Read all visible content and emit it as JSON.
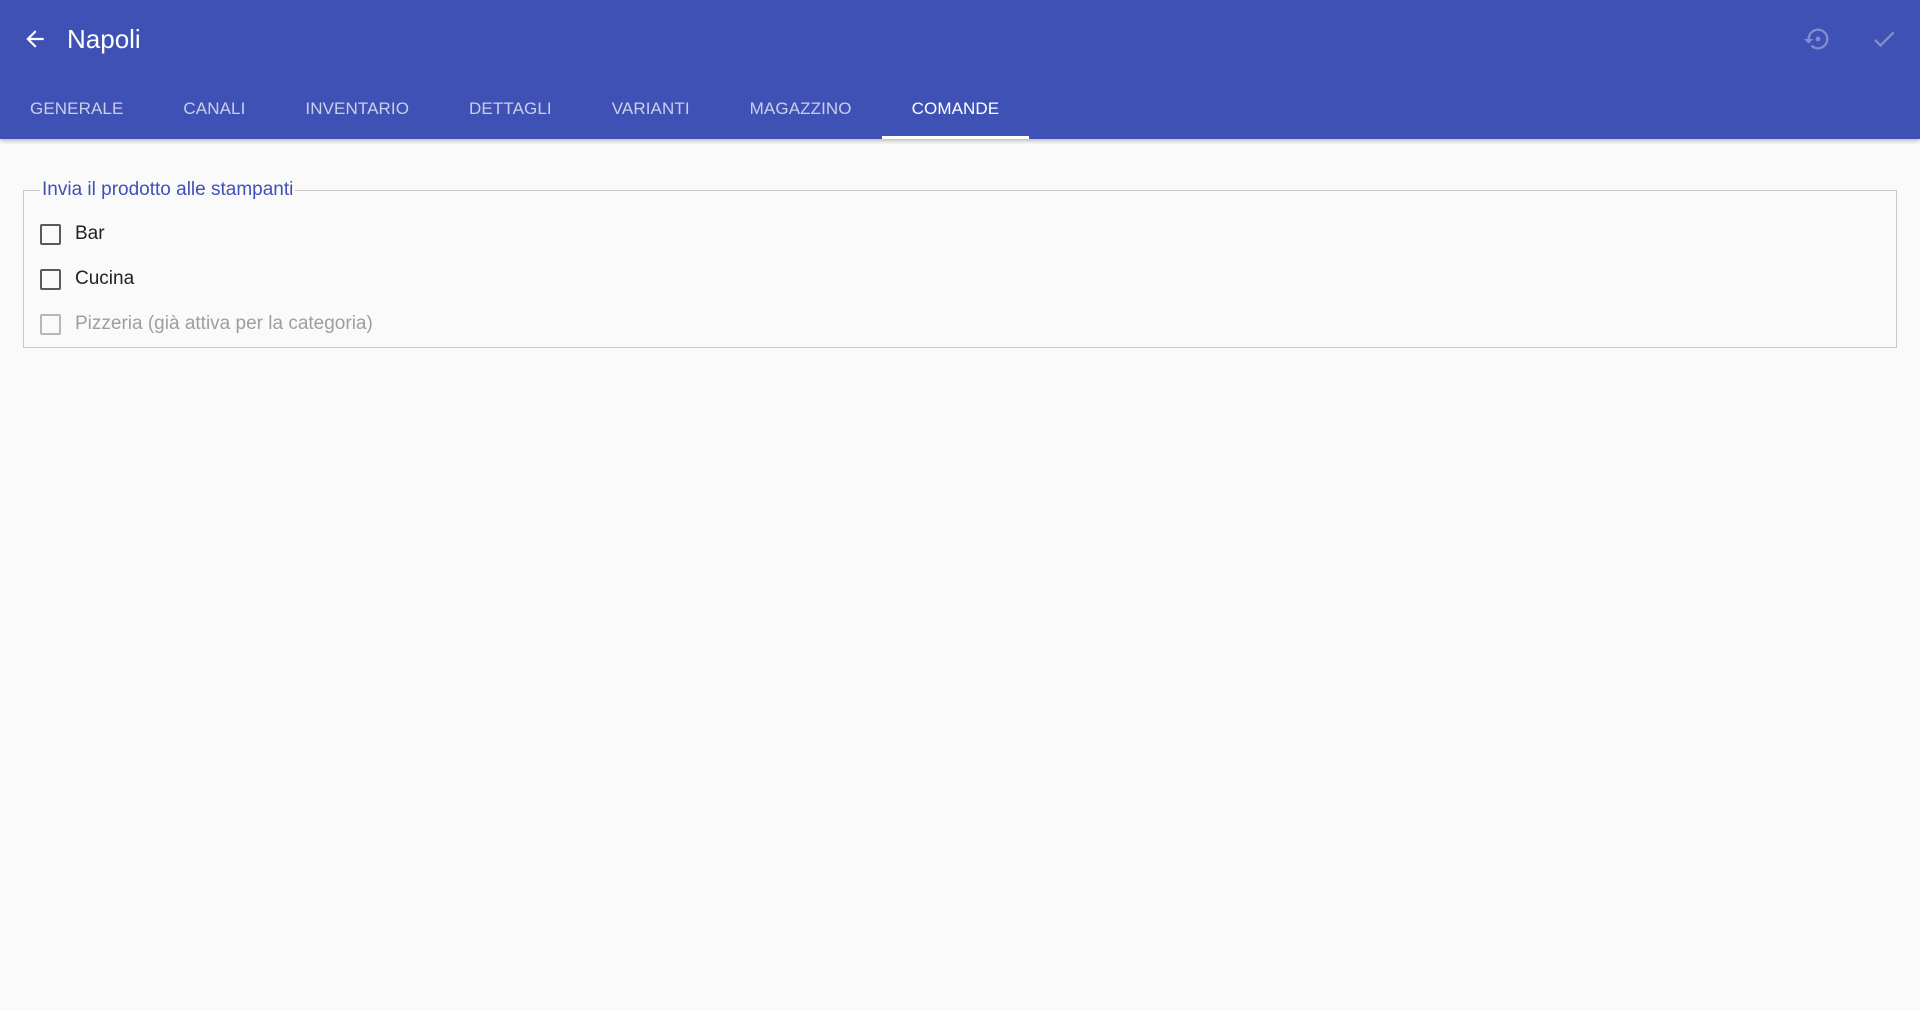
{
  "header": {
    "title": "Napoli",
    "back_icon": "arrow-back-icon",
    "actions": [
      {
        "icon": "restore-icon"
      },
      {
        "icon": "check-icon"
      }
    ]
  },
  "tabs": [
    {
      "label": "GENERALE",
      "active": false
    },
    {
      "label": "CANALI",
      "active": false
    },
    {
      "label": "INVENTARIO",
      "active": false
    },
    {
      "label": "DETTAGLI",
      "active": false
    },
    {
      "label": "VARIANTI",
      "active": false
    },
    {
      "label": "MAGAZZINO",
      "active": false
    },
    {
      "label": "COMANDE",
      "active": true
    }
  ],
  "printers": {
    "legend": "Invia il prodotto alle stampanti",
    "options": [
      {
        "label": "Bar",
        "checked": false,
        "disabled": false
      },
      {
        "label": "Cucina",
        "checked": false,
        "disabled": false
      },
      {
        "label": "Pizzeria (già attiva per la categoria)",
        "checked": false,
        "disabled": true
      }
    ]
  },
  "colors": {
    "primary": "#3f51b5",
    "background": "#fafafa",
    "legend": "#3f51b5",
    "disabled_text": "#9e9e9e"
  }
}
